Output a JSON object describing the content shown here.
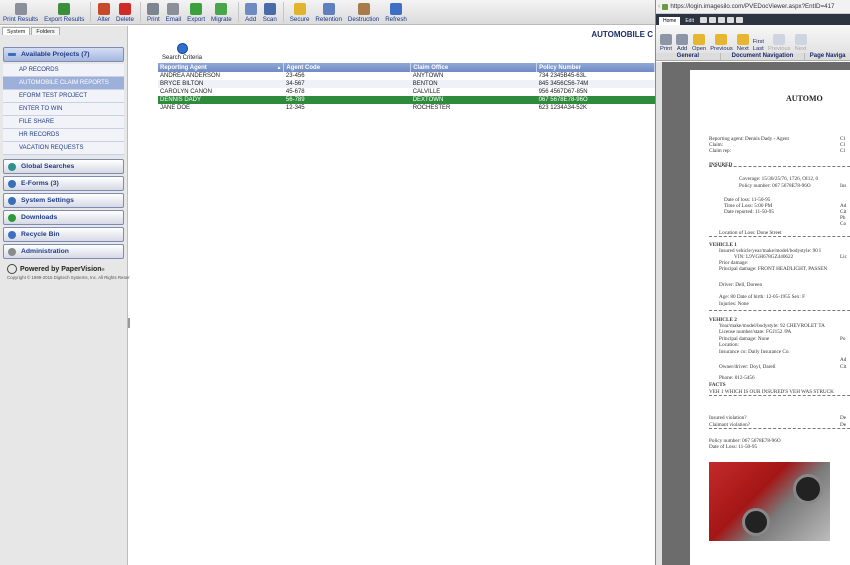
{
  "toolbar": {
    "buttons": [
      {
        "label": "Print Results",
        "icon": "print-results-icon",
        "color": "#8a9099"
      },
      {
        "label": "Export Results",
        "icon": "export-results-icon",
        "color": "#3b8f3b"
      },
      {
        "label": "Alter",
        "icon": "alter-icon",
        "color": "#c64a2a"
      },
      {
        "label": "Delete",
        "icon": "delete-icon",
        "color": "#d02a2a"
      },
      {
        "label": "Print",
        "icon": "print-icon",
        "color": "#7d8590"
      },
      {
        "label": "Email",
        "icon": "email-icon",
        "color": "#8a8f99"
      },
      {
        "label": "Export",
        "icon": "export-icon",
        "color": "#3ca13c"
      },
      {
        "label": "Migrate",
        "icon": "migrate-icon",
        "color": "#48a648"
      },
      {
        "label": "Add",
        "icon": "add-icon",
        "color": "#6f8bc4"
      },
      {
        "label": "Scan",
        "icon": "scan-icon",
        "color": "#4a6aa8"
      },
      {
        "label": "Secure",
        "icon": "secure-icon",
        "color": "#e0b52a"
      },
      {
        "label": "Retention",
        "icon": "retention-icon",
        "color": "#5f7fbf"
      },
      {
        "label": "Destruction",
        "icon": "destruction-icon",
        "color": "#a87b4a"
      },
      {
        "label": "Refresh",
        "icon": "refresh-icon",
        "color": "#3f6fc4"
      }
    ]
  },
  "sidebar": {
    "tabs": [
      "System",
      "Folders"
    ],
    "available_projects": "Available Projects (7)",
    "projects": [
      "AP RECORDS",
      "AUTOMOBILE CLAIM REPORTS",
      "EFORM TEST PROJECT",
      "ENTER TO WIN",
      "FILE SHARE",
      "HR RECORDS",
      "VACATION REQUESTS"
    ],
    "sections": [
      {
        "label": "Global Searches",
        "icon": "globe-icon",
        "color": "#2f8f8f"
      },
      {
        "label": "E-Forms (3)",
        "icon": "plus-icon",
        "color": "#3a6fb8"
      },
      {
        "label": "System Settings",
        "icon": "plus-icon",
        "color": "#3a6fb8"
      },
      {
        "label": "Downloads",
        "icon": "download-icon",
        "color": "#2d9a3a"
      },
      {
        "label": "Recycle Bin",
        "icon": "recycle-bin-icon",
        "color": "#3f6fbf"
      },
      {
        "label": "Administration",
        "icon": "admin-icon",
        "color": "#8a8a8a"
      }
    ],
    "powered_by": "Powered by PaperVision",
    "copyright": "Copyright © 1999-2015 Digitech Systems, Inc. All Rights Reserved"
  },
  "main": {
    "title": "AUTOMOBILE C",
    "search_label": "Search Criteria",
    "columns": [
      "Reporting Agent",
      "Agent Code",
      "Claim Office",
      "Policy Number"
    ],
    "rows": [
      [
        "ANDREA ANDERSON",
        "23-456",
        "ANYTOWN",
        "734 2345B45-63L"
      ],
      [
        "BRYCE BILTON",
        "34-567",
        "BENTON",
        "845 3456C56-74M"
      ],
      [
        "CAROLYN CANON",
        "45-678",
        "CALVILLE",
        "956 4567D67-85N"
      ],
      [
        "DENNIS DADY",
        "56-789",
        "DEXTOWN",
        "067 5678E78-96O"
      ],
      [
        "JANE DOE",
        "12-345",
        "ROCHESTER",
        "623 1234A34-52K"
      ]
    ],
    "selected_row": 3
  },
  "viewer": {
    "url": "https://login.imagesilo.com/PVEDocViewer.aspx?EntID=417",
    "tabs": [
      "Home",
      "Edit"
    ],
    "ribbon": [
      {
        "label": "Print",
        "icon": "print-icon",
        "enabled": true
      },
      {
        "label": "Add",
        "icon": "add-page-icon",
        "enabled": true
      },
      {
        "label": "Open",
        "icon": "open-icon",
        "enabled": true
      },
      {
        "label": "Previous",
        "icon": "folder-previous-icon",
        "enabled": true
      },
      {
        "label": "Next",
        "icon": "folder-next-icon",
        "enabled": true
      }
    ],
    "first_label": "First",
    "last_label": "Last",
    "page_prev": "Previous",
    "page_next": "Next",
    "groups": [
      "General",
      "Document Navigation",
      "Page Naviga"
    ],
    "doc": {
      "heading": "AUTOMO",
      "lines": [
        "Reporting agent:  Dennis Dady - Agent",
        "Claim:",
        "Claim rep:",
        "INSURED",
        "Coverage:  15/30/25/76, 1726, OI12, 0",
        "Policy number:  067  5678E78-96O",
        "Date of loss:  11-50-95",
        "Time of Loss:  5:00 PM",
        "Date reported:  11-50-95",
        "Location of Loss:  Done Street",
        "VEHICLE 1",
        "Insured vehicle/year/make/model/bodystyle:  90 I",
        "VIN:  L9VGH678GZ440622",
        "Prior damage:",
        "Principal damage:  FRONT HEADLIGHT, PASSEN",
        "Driver:  Dell, Doreen",
        "Age:  80     Date of birth:  12-05-1955    Sex:  F",
        "Injuries:  None",
        "VEHICLE 2",
        "Year/make/model/bodystyle:  92 CHEVROLET TA",
        "License number/state:  FGJ152 /PA",
        "Principal damage:  None",
        "Location:",
        "Insurance co:  Daily Insurance Co.",
        "Owner/driver:  Doyl, Darell",
        "Phone:  012-5456",
        "FACTS",
        "VEH 1 WHICH IS OUR INSURED'S VEH WAS STRUCK",
        "Insured violation?",
        "Claimant violation?",
        "Policy number:  067  5678E78-96O",
        "Date of Loss:  11-50-95"
      ],
      "right_labels": [
        "Cl",
        "Cl",
        "Cl",
        "Ins",
        "Ad",
        "Cit",
        "Ph",
        "Co",
        "Lic",
        "Po",
        "Ad",
        "Cit",
        "De",
        "De"
      ]
    }
  }
}
